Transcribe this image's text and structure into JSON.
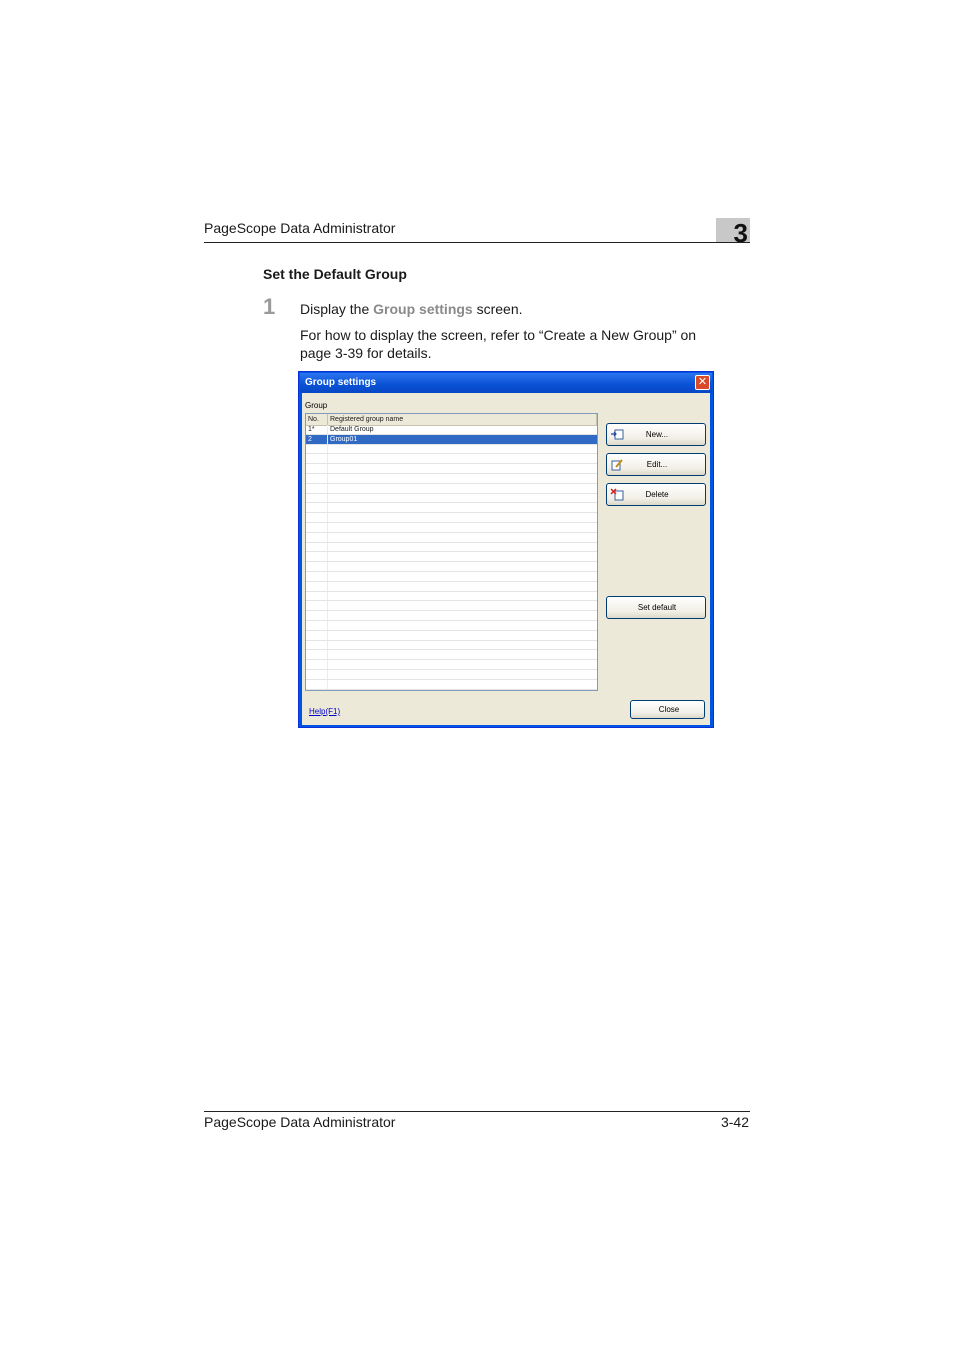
{
  "header": {
    "title": "PageScope Data Administrator",
    "chapter": "3"
  },
  "section_title": "Set the Default Group",
  "step": {
    "number": "1",
    "text_before": "Display the ",
    "highlight": "Group settings",
    "text_after": " screen.",
    "note": "For how to display the screen, refer to “Create a New Group” on page 3-39 for details."
  },
  "dialog": {
    "title": "Group settings",
    "close_glyph": "✕",
    "group_label": "Group",
    "columns": [
      "No.",
      "Registered group name"
    ],
    "rows": [
      {
        "no": "1*",
        "name": "Default Group",
        "selected": false
      },
      {
        "no": "2",
        "name": "Group01",
        "selected": true
      }
    ],
    "buttons": {
      "new": "New...",
      "edit": "Edit...",
      "delete": "Delete",
      "set_default": "Set default",
      "close": "Close"
    },
    "help_link": "Help(F1)"
  },
  "footer": {
    "title": "PageScope Data Administrator",
    "page": "3-42"
  }
}
